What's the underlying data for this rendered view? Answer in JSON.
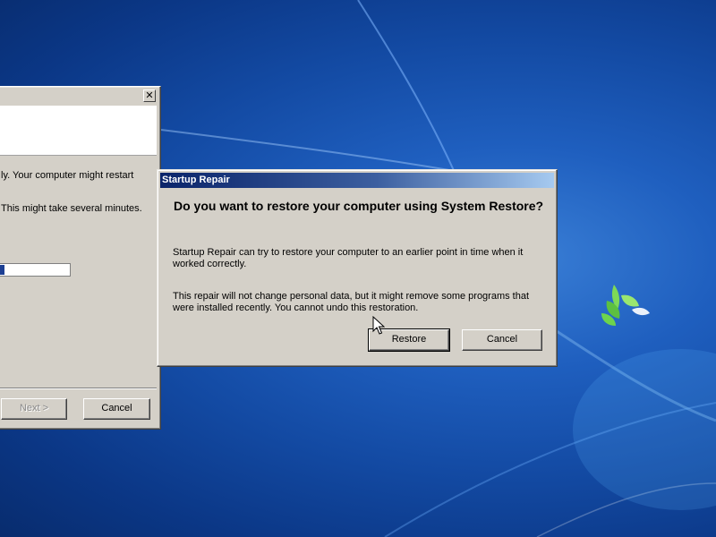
{
  "background_window": {
    "close_glyph": "✕",
    "text_line1": "ly. Your computer might restart",
    "text_line2": "This might take several minutes.",
    "progress": 0.06,
    "next_label": "Next >",
    "cancel_label": "Cancel"
  },
  "dialog": {
    "title": "Startup Repair",
    "question": "Do you want to restore your computer using System Restore?",
    "paragraph1": "Startup Repair can try to restore your computer to an earlier point in time when it worked correctly.",
    "paragraph2": "This repair will not change personal data, but it might remove some programs that were installed recently. You cannot undo this restoration.",
    "restore_label": "Restore",
    "cancel_label": "Cancel"
  },
  "colors": {
    "desktop": "#1f5fbf",
    "titlebar_start": "#0a246a",
    "titlebar_end": "#a6caf0",
    "window_face": "#d4d0c8",
    "progress_fill": "#1d3f93"
  },
  "icons": {
    "cursor": "arrow-cursor-icon",
    "wallpaper_logo": "windows-leaf-logo"
  }
}
